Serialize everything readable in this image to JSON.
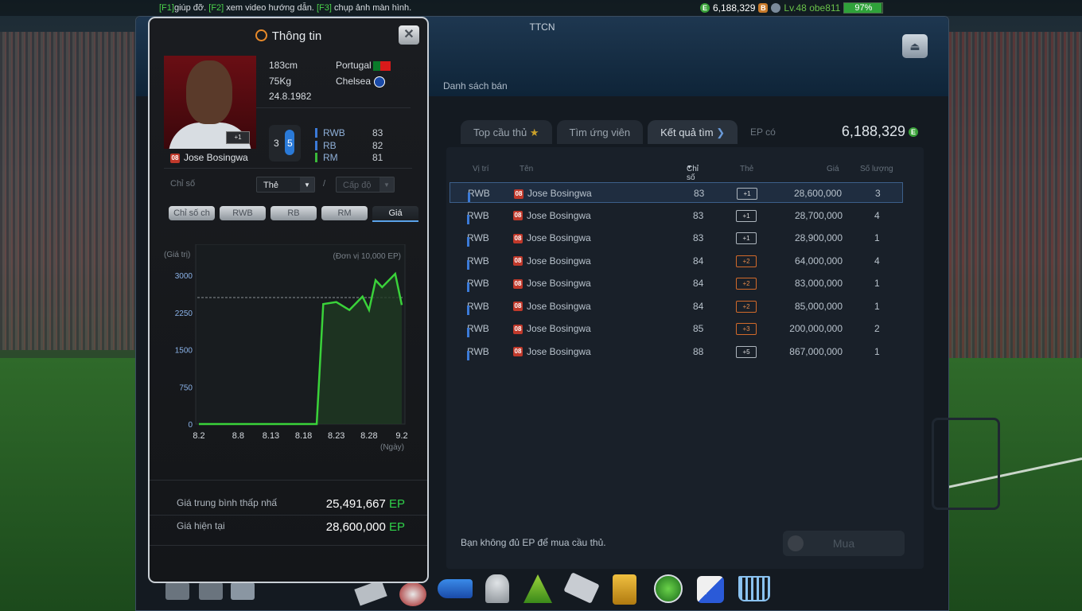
{
  "topbar": {
    "hint_k1": "[F1]",
    "hint_t1": "giúp đỡ.",
    "hint_k2": "[F2]",
    "hint_t2": "xem video hướng dẫn.",
    "hint_k3": "[F3]",
    "hint_t3": "chụp ảnh màn hình.",
    "ep_amount": "6,188,329",
    "level": "Lv.48 obe811",
    "battery": "97%",
    "battery_level": 97
  },
  "main": {
    "title": "TTCN",
    "subtab": "Danh sách bán",
    "tabs": [
      "Top cầu thủ",
      "Tìm ứng viên",
      "Kết quả tìm"
    ],
    "ep_label": "EP có",
    "ep_value": "6,188,329",
    "columns": {
      "position": "Vị trí",
      "name": "Tên",
      "ovr": "Chỉ số",
      "card": "Thẻ",
      "price": "Giá",
      "qty": "Số lượng"
    },
    "rows": [
      {
        "pos": "RWB",
        "season": "08",
        "name": "Jose Bosingwa",
        "ovr": "83",
        "card": "+1",
        "price": "28,600,000",
        "qty": "3"
      },
      {
        "pos": "RWB",
        "season": "08",
        "name": "Jose Bosingwa",
        "ovr": "83",
        "card": "+1",
        "price": "28,700,000",
        "qty": "4"
      },
      {
        "pos": "RWB",
        "season": "08",
        "name": "Jose Bosingwa",
        "ovr": "83",
        "card": "+1",
        "price": "28,900,000",
        "qty": "1"
      },
      {
        "pos": "RWB",
        "season": "08",
        "name": "Jose Bosingwa",
        "ovr": "84",
        "card": "+2",
        "price": "64,000,000",
        "qty": "4"
      },
      {
        "pos": "RWB",
        "season": "08",
        "name": "Jose Bosingwa",
        "ovr": "84",
        "card": "+2",
        "price": "83,000,000",
        "qty": "1"
      },
      {
        "pos": "RWB",
        "season": "08",
        "name": "Jose Bosingwa",
        "ovr": "84",
        "card": "+2",
        "price": "85,000,000",
        "qty": "1"
      },
      {
        "pos": "RWB",
        "season": "08",
        "name": "Jose Bosingwa",
        "ovr": "85",
        "card": "+3",
        "price": "200,000,000",
        "qty": "2"
      },
      {
        "pos": "RWB",
        "season": "08",
        "name": "Jose Bosingwa",
        "ovr": "88",
        "card": "+5",
        "price": "867,000,000",
        "qty": "1"
      }
    ],
    "message": "Bạn không đủ EP để mua cầu thủ.",
    "buy_label": "Mua"
  },
  "info": {
    "title": "Thông tin",
    "height": "183cm",
    "weight": "75Kg",
    "dob": "24.8.1982",
    "nation": "Portugal",
    "club": "Chelsea",
    "season": "08",
    "card_level": "+1",
    "player_name": "Jose Bosingwa",
    "weak_foot": "3",
    "strong_foot": "5",
    "positions": [
      {
        "label": "RWB",
        "value": "83"
      },
      {
        "label": "RB",
        "value": "82"
      },
      {
        "label": "RM",
        "value": "81"
      }
    ],
    "stat_label": "Chỉ số",
    "card_select": "Thẻ",
    "slash": "/",
    "level_select": "Cấp độ",
    "stat_tabs": [
      "Chỉ số ch",
      "RWB",
      "RB",
      "RM",
      "Giá"
    ],
    "avg_label": "Giá trung bình thấp nhấ",
    "avg_value": "25,491,667",
    "cur_label": "Giá hiện tại",
    "cur_value": "28,600,000",
    "ep_unit": "EP"
  },
  "chart_data": {
    "type": "area",
    "ylabel": "(Giá trị)",
    "unit_note": "(Đơn vị 10,000 EP)",
    "xlabel": "(Ngày)",
    "yticks": [
      0,
      750,
      1500,
      2250,
      3000
    ],
    "xticks": [
      "8.2",
      "8.8",
      "8.13",
      "8.18",
      "8.23",
      "8.28",
      "9.2"
    ],
    "ylim": [
      0,
      3000
    ],
    "reference_line": 2550,
    "series": [
      {
        "values": [
          {
            "x": "8.2",
            "y": 0
          },
          {
            "x": "8.8",
            "y": 0
          },
          {
            "x": "8.13",
            "y": 0
          },
          {
            "x": "8.18",
            "y": 0
          },
          {
            "x": "8.20",
            "y": 0
          },
          {
            "x": "8.21",
            "y": 2420
          },
          {
            "x": "8.23",
            "y": 2460
          },
          {
            "x": "8.25",
            "y": 2300
          },
          {
            "x": "8.27",
            "y": 2570
          },
          {
            "x": "8.28",
            "y": 2300
          },
          {
            "x": "8.29",
            "y": 2900
          },
          {
            "x": "8.30",
            "y": 2760
          },
          {
            "x": "9.1",
            "y": 3030
          },
          {
            "x": "9.2",
            "y": 2400
          }
        ]
      }
    ],
    "line_color": "#3ad23a"
  }
}
